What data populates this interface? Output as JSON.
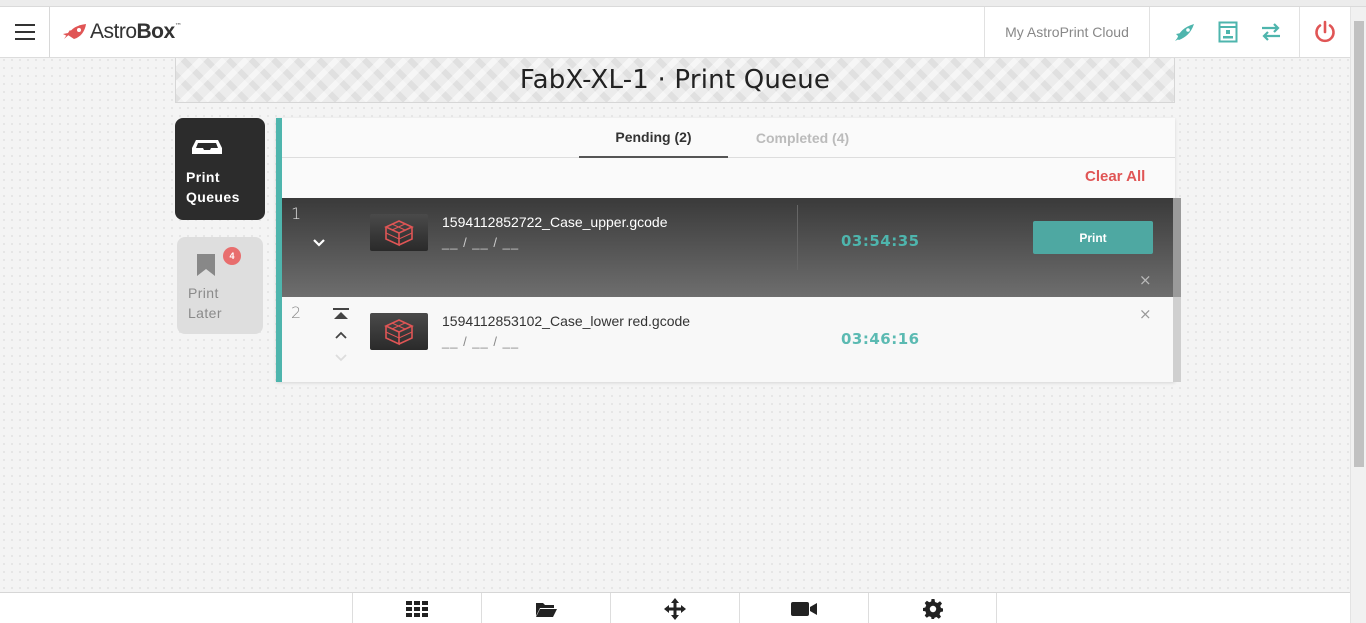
{
  "app": {
    "brand_regular": "Astro",
    "brand_bold": "Box",
    "brand_tm": "™"
  },
  "header": {
    "cloud_label": "My AstroPrint Cloud",
    "icons": [
      "rocket-icon",
      "printer-status-icon",
      "transfer-arrows-icon",
      "power-icon"
    ],
    "accent_color": "#4eb5ad",
    "power_color": "#e05555"
  },
  "page": {
    "title": "FabX-XL-1 · Print Queue"
  },
  "sidebar": {
    "queues": {
      "label": "Print Queues"
    },
    "later": {
      "label": "Print Later",
      "badge": "4"
    }
  },
  "tabs": {
    "pending": "Pending (2)",
    "completed": "Completed (4)",
    "active": "pending"
  },
  "actions": {
    "clear_all": "Clear All"
  },
  "queue": [
    {
      "index": "1",
      "file": "1594112852722_Case_upper.gcode",
      "dates": "__ / __ / __",
      "time": "03:54:35",
      "print_label": "Print",
      "close": "×"
    },
    {
      "index": "2",
      "file": "1594112853102_Case_lower red.gcode",
      "dates": "__ / __ / __",
      "time": "03:46:16",
      "close": "×"
    }
  ],
  "bottom_nav": [
    "grid-icon",
    "folder-icon",
    "move-icon",
    "camera-icon",
    "settings-icon"
  ]
}
